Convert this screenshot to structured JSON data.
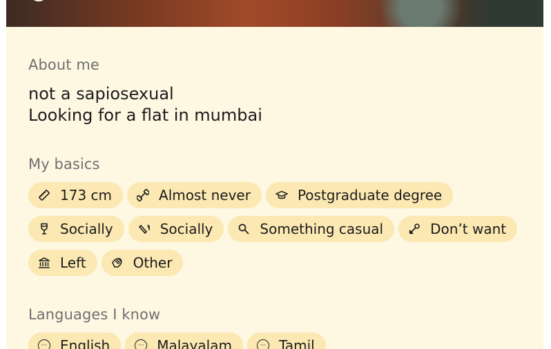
{
  "about": {
    "heading": "About me",
    "line1": "not a sapiosexual",
    "line2": "Looking for a flat in mumbai"
  },
  "basics": {
    "heading": "My basics",
    "height": "173 cm",
    "exercise": "Almost never",
    "education": "Postgraduate degree",
    "drinking": "Socially",
    "smoking": "Socially",
    "looking_for": "Something casual",
    "kids": "Don’t want",
    "politics": "Left",
    "religion": "Other"
  },
  "languages": {
    "heading": "Languages I know",
    "items": [
      "English",
      "Malayalam",
      "Tamil"
    ]
  }
}
